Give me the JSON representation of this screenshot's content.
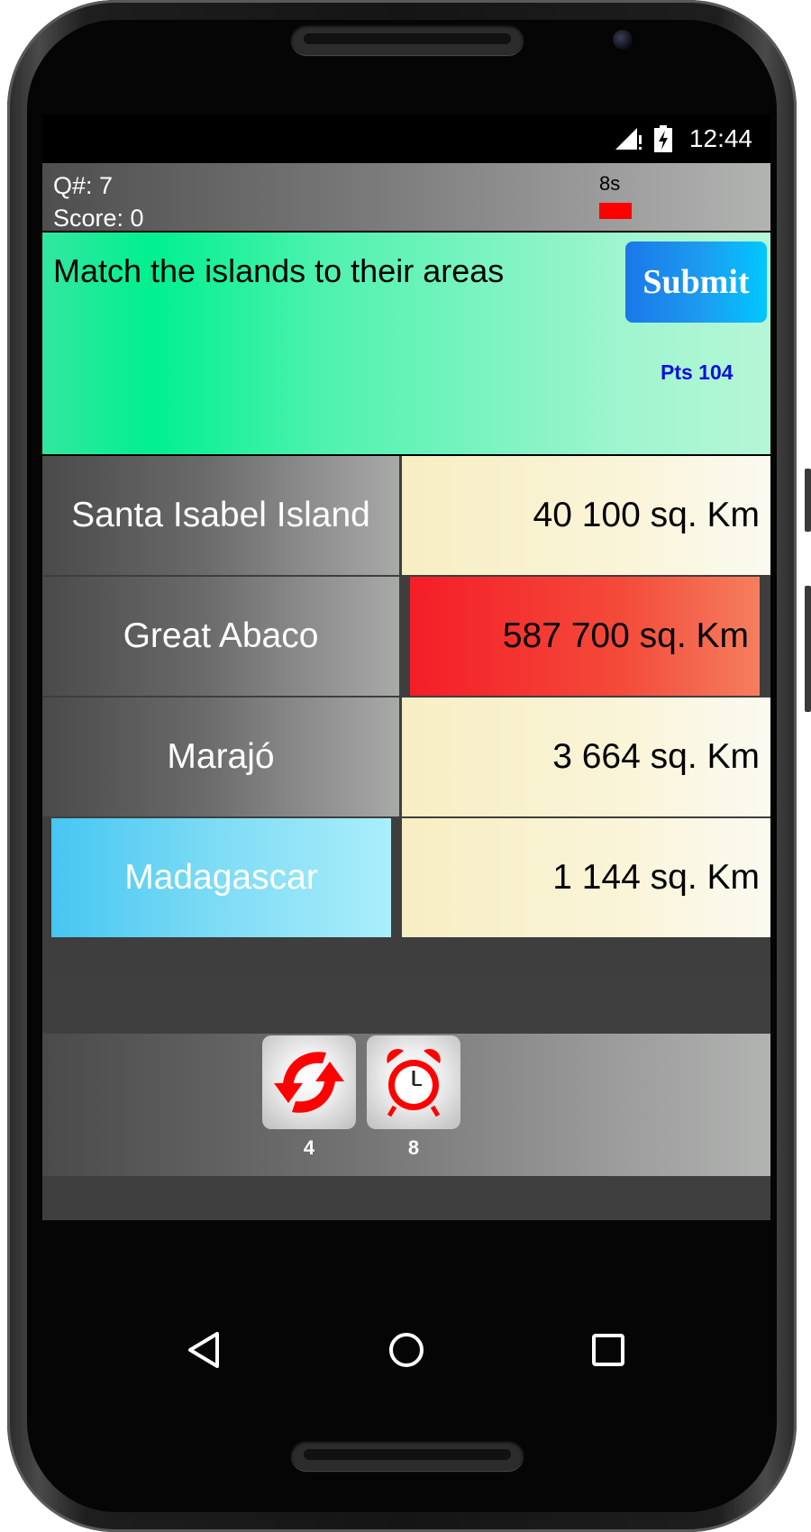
{
  "status_bar": {
    "time": "12:44"
  },
  "header": {
    "question_number": "Q#: 7",
    "score": "Score: 0",
    "timer": "8s"
  },
  "question": {
    "text": "Match the islands to their areas",
    "submit_label": "Submit",
    "points": "Pts 104"
  },
  "pairs": [
    {
      "island": "Santa Isabel Island",
      "area": "40 100 sq. Km"
    },
    {
      "island": "Great Abaco",
      "area": "587 700 sq. Km",
      "area_state": "wrong"
    },
    {
      "island": "Marajó",
      "area": "3 664 sq. Km"
    },
    {
      "island": "Madagascar",
      "area": "1 144 sq. Km",
      "island_state": "selected"
    }
  ],
  "powerups": [
    {
      "icon": "refresh-icon",
      "count": "4"
    },
    {
      "icon": "alarm-clock-icon",
      "count": "8"
    }
  ],
  "colors": {
    "question_bg": "#00f08f",
    "submit_bg": "#1d9cf0",
    "points_text": "#1010d8",
    "timer_bar": "#ff0000",
    "wrong_cell": "#f41d27",
    "selected_cell": "#46c6f2"
  },
  "nav": [
    "back-icon",
    "home-icon",
    "recents-icon"
  ]
}
